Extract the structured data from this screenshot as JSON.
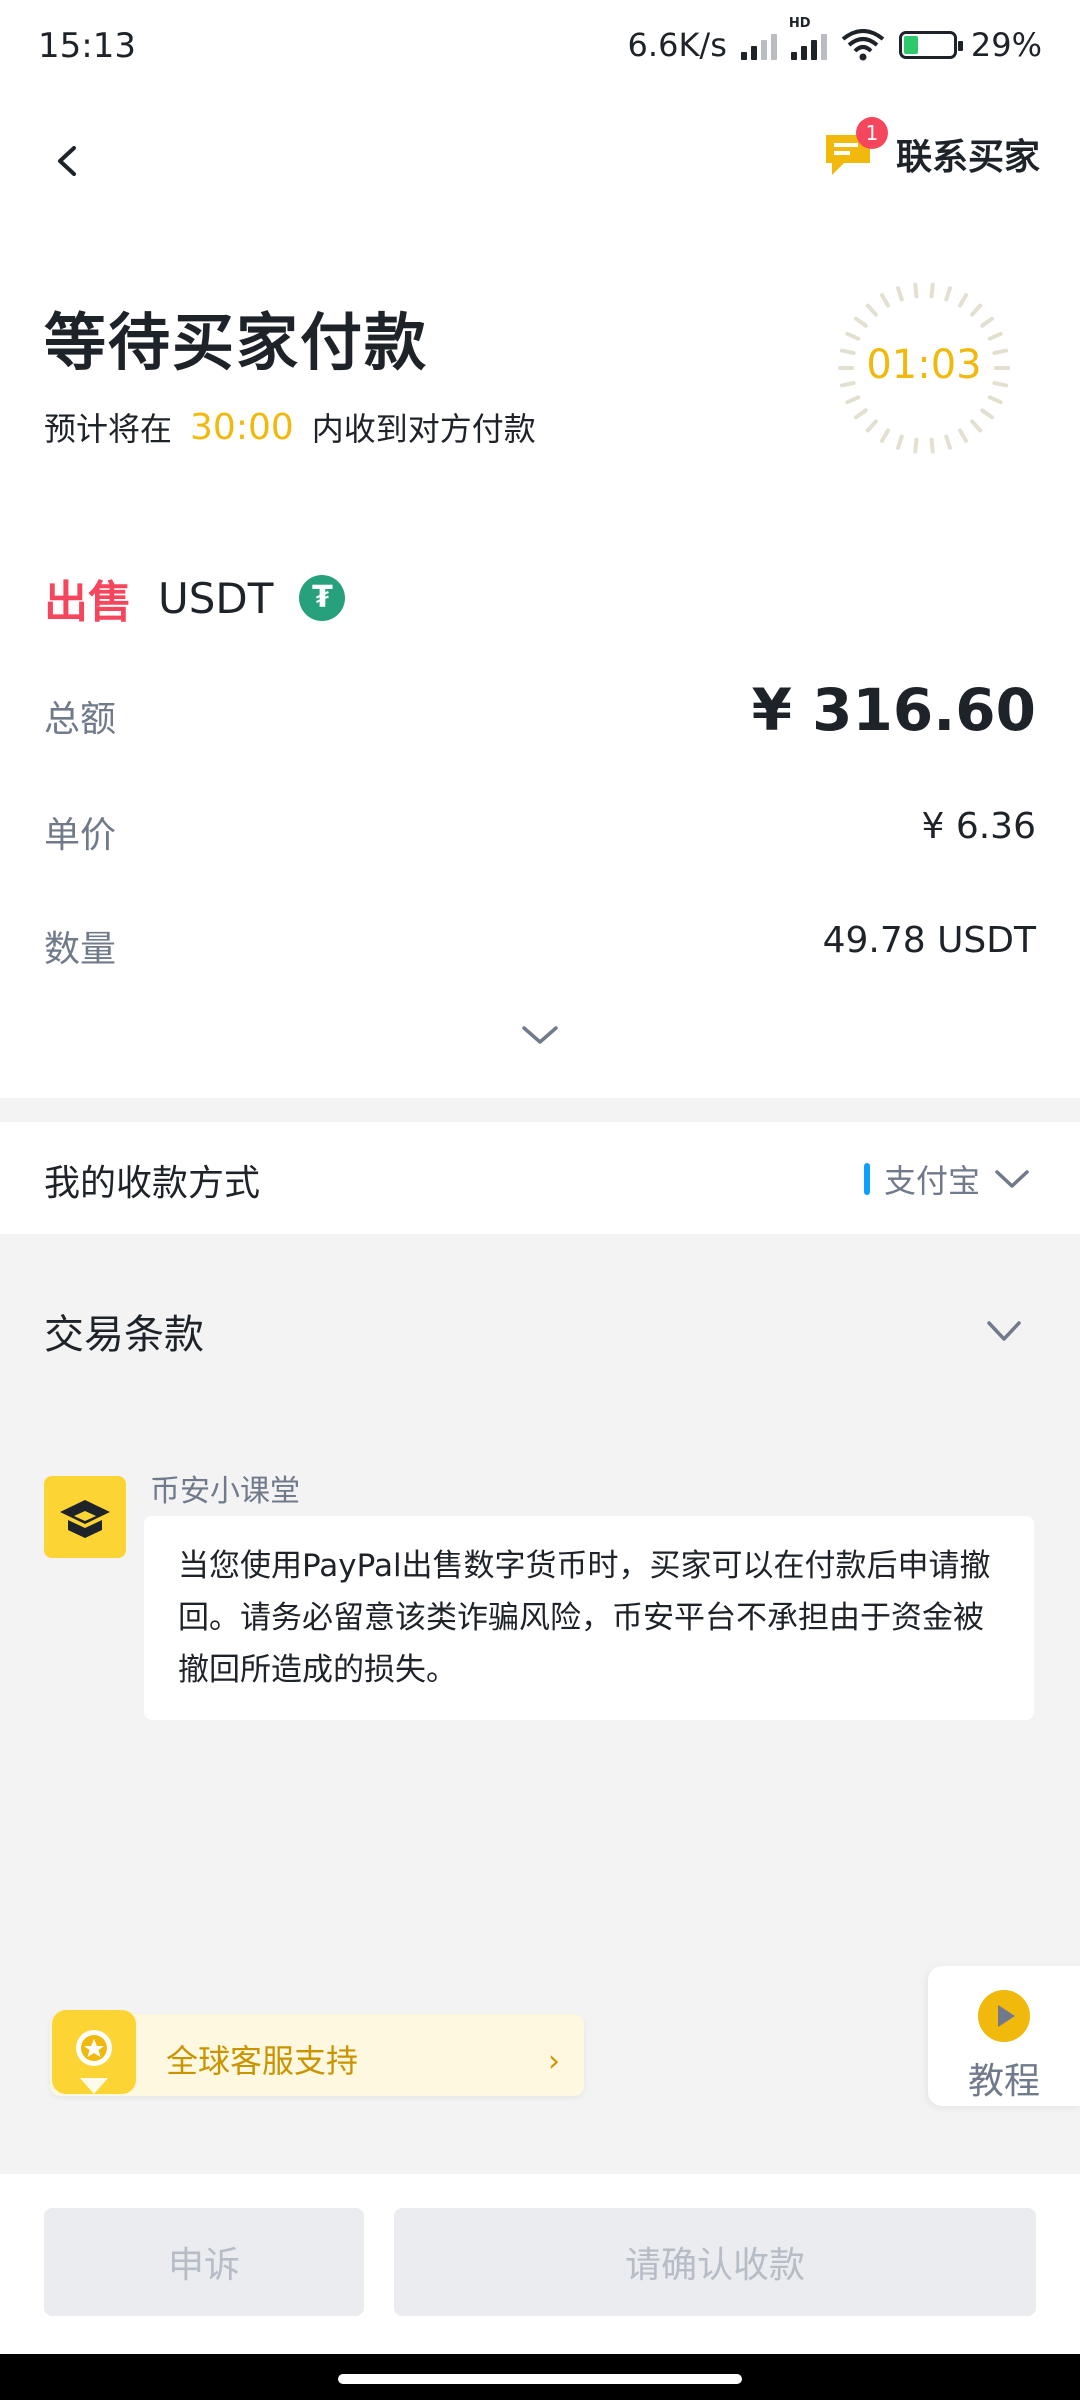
{
  "status_bar": {
    "time": "15:13",
    "net_speed": "6.6K/s",
    "hd_label": "HD",
    "battery": "29%"
  },
  "header": {
    "back_icon": "chevron-left-icon",
    "contact_label": "联系买家",
    "unread_count": "1"
  },
  "status": {
    "title": "等待买家付款",
    "sub_prefix": "预计将在",
    "sub_time": "30:00",
    "sub_suffix": "内收到对方付款",
    "countdown": "01:03"
  },
  "order": {
    "side_label": "出售",
    "asset": "USDT",
    "asset_icon_glyph": "₮",
    "rows": [
      {
        "label": "总额",
        "value": "¥ 316.60"
      },
      {
        "label": "单价",
        "value": "¥ 6.36"
      },
      {
        "label": "数量",
        "value": "49.78 USDT"
      }
    ]
  },
  "payment": {
    "label": "我的收款方式",
    "method": "支付宝",
    "accent": "#0e9fff"
  },
  "terms": {
    "label": "交易条款"
  },
  "tip": {
    "source": "币安小课堂",
    "text": "当您使用PayPal出售数字货币时，买家可以在付款后申请撤回。请务必留意该类诈骗风险，币安平台不承担由于资金被撤回所造成的损失。"
  },
  "support": {
    "label": "全球客服支持",
    "arrow": "›"
  },
  "tutorial": {
    "label": "教程"
  },
  "actions": {
    "appeal": "申诉",
    "confirm": "请确认收款"
  },
  "colors": {
    "brand_yellow": "#f0b90b",
    "sell_red": "#f6465d",
    "usdt_green": "#26a17b"
  }
}
